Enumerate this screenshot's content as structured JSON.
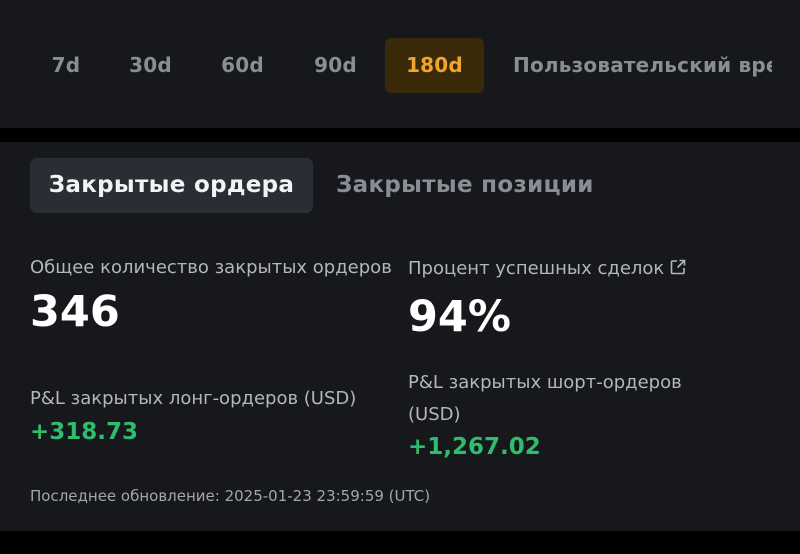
{
  "periods": {
    "tabs": [
      {
        "label": "7d"
      },
      {
        "label": "30d"
      },
      {
        "label": "60d"
      },
      {
        "label": "90d"
      },
      {
        "label": "180d",
        "active": true
      },
      {
        "label": "Пользовательский врем"
      }
    ],
    "active_color": "#f0a52b"
  },
  "view_tabs": {
    "closed_orders": "Закрытые ордера",
    "closed_positions": "Закрытые позиции",
    "active": "closed_orders"
  },
  "stats": {
    "total_closed_orders": {
      "label": "Общее количество закрытых ордеров",
      "value": "346"
    },
    "win_rate": {
      "label": "Процент успешных сделок",
      "value": "94%",
      "icon": "external-link-icon"
    },
    "long_pnl": {
      "label": "P&L закрытых лонг-ордеров (USD)",
      "value": "+318.73"
    },
    "short_pnl": {
      "label": "P&L закрытых шорт-ордеров (USD)",
      "value": "+1,267.02"
    }
  },
  "last_updated": "Последнее обновление: 2025-01-23 23:59:59 (UTC)",
  "colors": {
    "positive": "#2ebd6f",
    "panel_bg": "#17181c",
    "page_bg": "#000000"
  }
}
